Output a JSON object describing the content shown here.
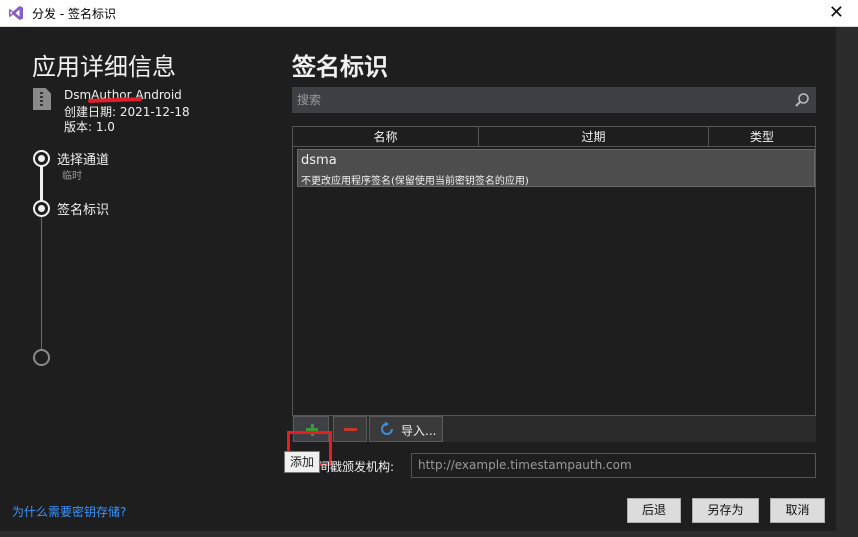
{
  "window": {
    "title": "分发 - 签名标识",
    "close_glyph": "✕"
  },
  "left": {
    "title": "应用详细信息",
    "app_name": "DsmAuthor Android",
    "app_date": "创建日期: 2021-12-18",
    "app_version": "版本: 1.0",
    "steps": [
      {
        "label": "选择通道",
        "sub": "临时"
      },
      {
        "label": "签名标识",
        "sub": ""
      }
    ],
    "help_link": "为什么需要密钥存储?"
  },
  "right": {
    "title": "签名标识",
    "search_placeholder": "搜索",
    "columns": [
      "名称",
      "过期",
      "类型"
    ],
    "rows": [
      {
        "name": "dsma",
        "desc": "不更改应用程序签名(保留使用当前密钥签名的应用)"
      }
    ],
    "toolbar": {
      "add_tooltip": "添加",
      "import_label": "导入..."
    },
    "timestamp_label": "时间戳颁发机构:",
    "timestamp_placeholder": "http://example.timestampauth.com"
  },
  "buttons": {
    "back": "后退",
    "save_as": "另存为",
    "cancel": "取消"
  },
  "colors": {
    "background": "#1e1e1e",
    "accent_link": "#3794ff",
    "highlight": "#e81c24",
    "add_green": "#3a9a3a",
    "remove_red": "#c0392b"
  }
}
